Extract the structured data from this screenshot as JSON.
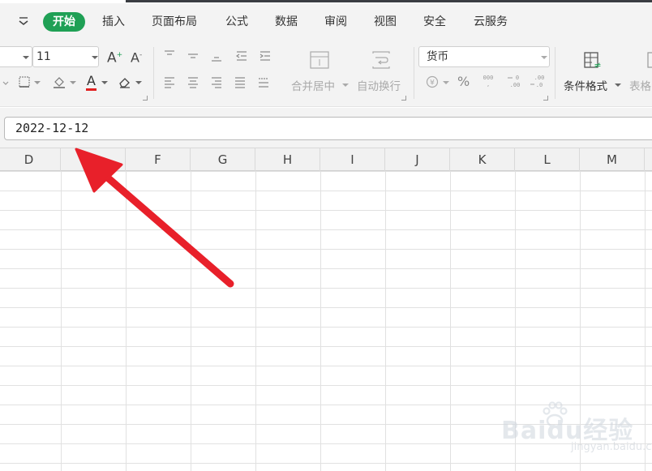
{
  "menu": {
    "items": [
      {
        "label": "开始",
        "active": true
      },
      {
        "label": "插入"
      },
      {
        "label": "页面布局"
      },
      {
        "label": "公式"
      },
      {
        "label": "数据"
      },
      {
        "label": "审阅"
      },
      {
        "label": "视图"
      },
      {
        "label": "安全"
      },
      {
        "label": "云服务"
      }
    ]
  },
  "ribbon": {
    "font_size": "11",
    "number_format": "货币",
    "merge_center_label": "合并居中",
    "wrap_text_label": "自动换行",
    "conditional_format_label": "条件格式",
    "table_style_label": "表格",
    "font_color_glyph": "A",
    "percent_glyph": "%",
    "grow_font_glyph": "A",
    "shrink_font_glyph": "A"
  },
  "formula_bar": {
    "value": "2022-12-12"
  },
  "columns": [
    "D",
    "E",
    "F",
    "G",
    "H",
    "I",
    "J",
    "K",
    "L",
    "M"
  ],
  "watermark": {
    "brand": "Baidu经验",
    "url": "jingyan.baidu.com"
  },
  "colors": {
    "accent_green": "#1fa055",
    "arrow_red": "#e8202a",
    "font_color_red": "#e02020"
  }
}
